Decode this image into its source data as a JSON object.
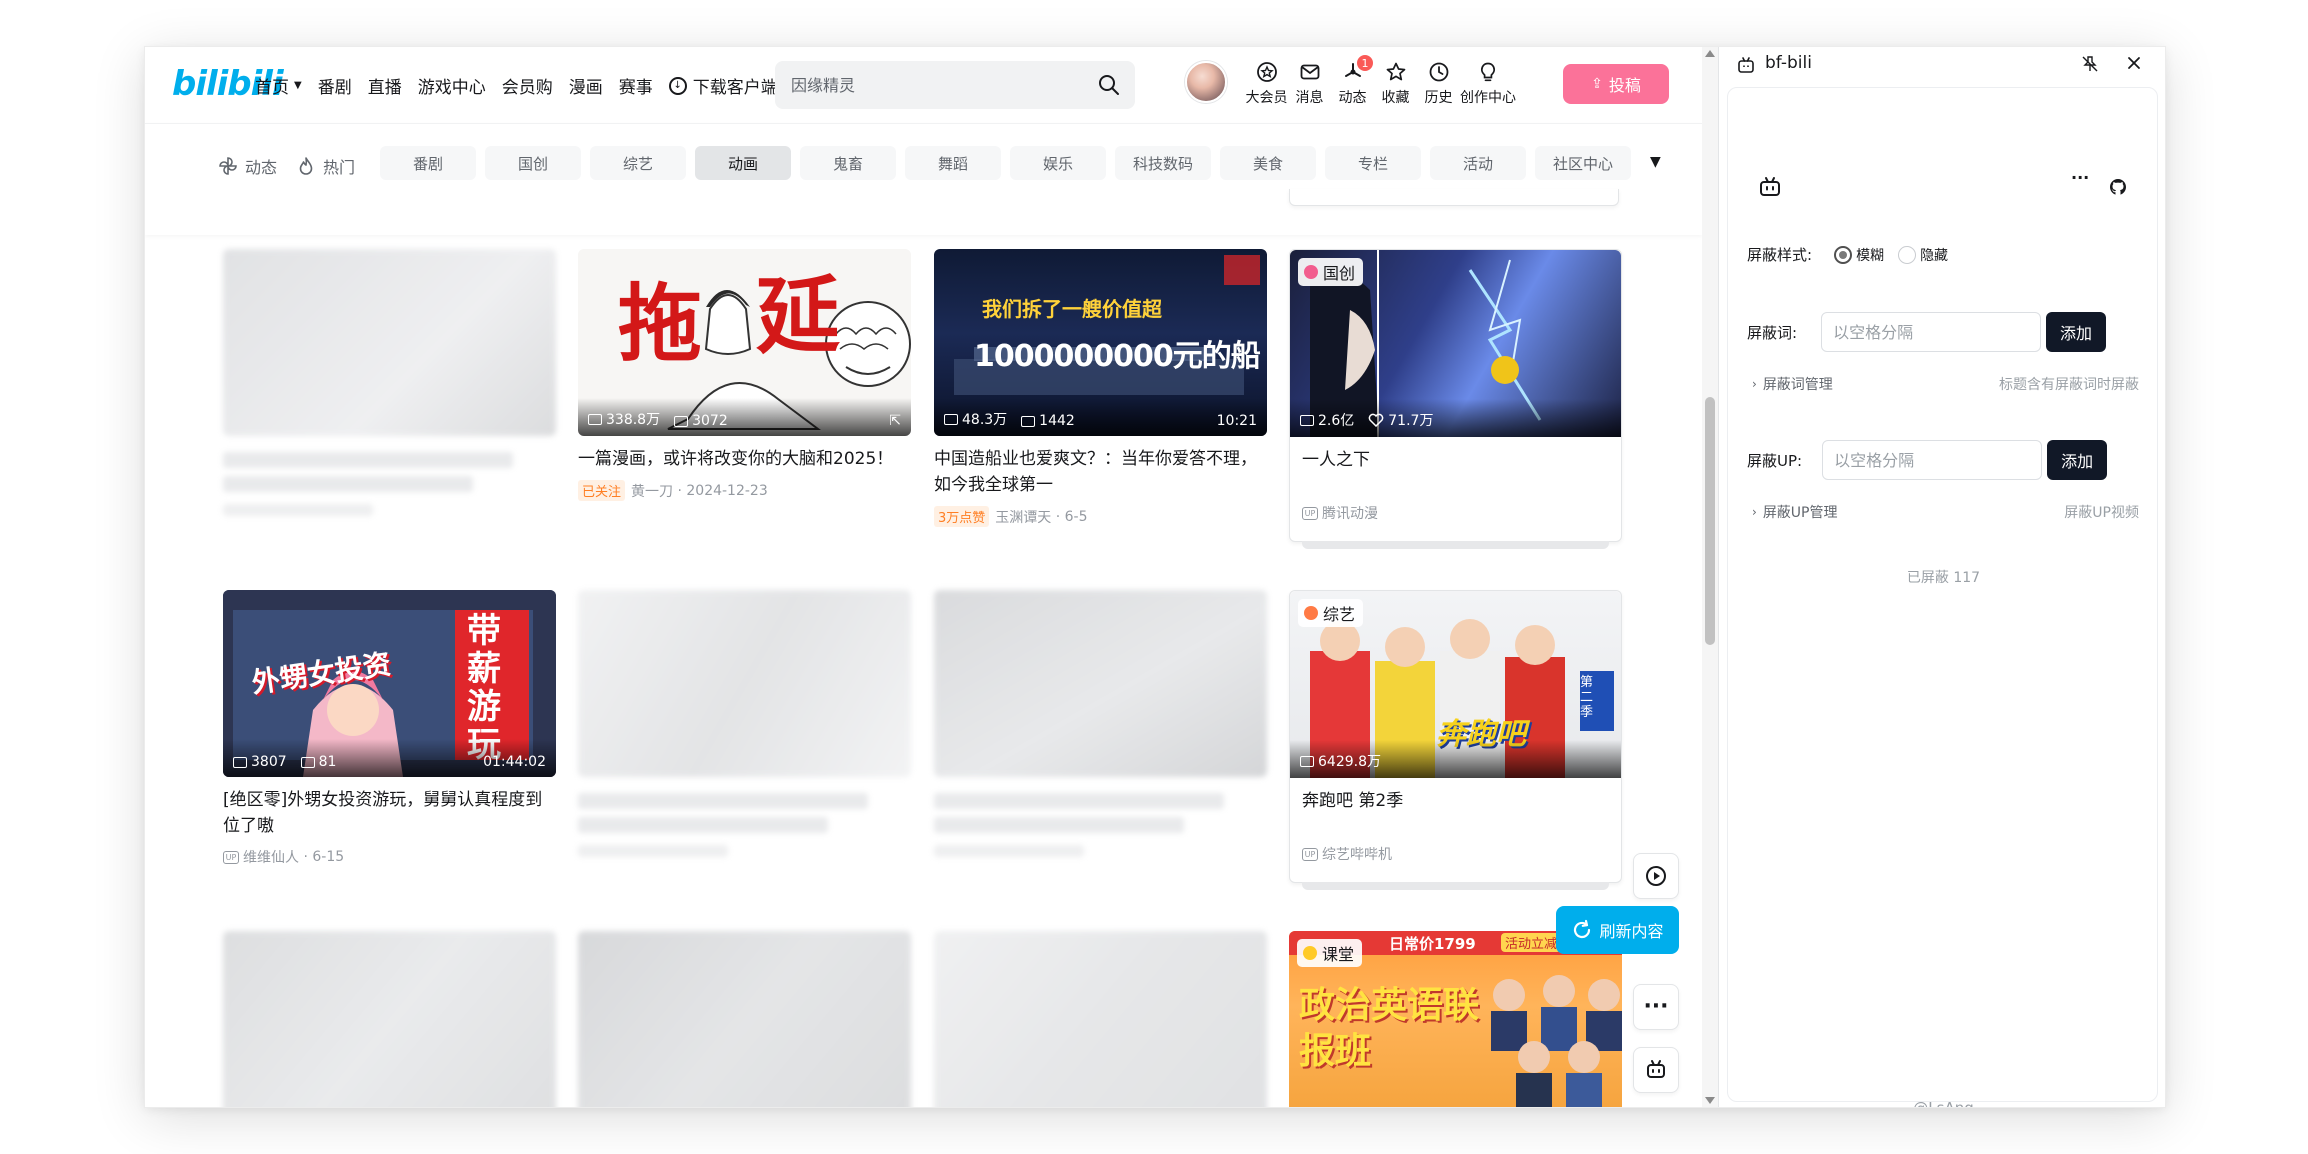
{
  "header": {
    "logo": "bilibili",
    "nav": [
      {
        "label": "首页",
        "has_dropdown": true
      },
      {
        "label": "番剧"
      },
      {
        "label": "直播"
      },
      {
        "label": "游戏中心"
      },
      {
        "label": "会员购"
      },
      {
        "label": "漫画"
      },
      {
        "label": "赛事"
      },
      {
        "label": "下载客户端",
        "icon": "download-icon"
      }
    ],
    "search_placeholder": "因缘精灵",
    "icons": [
      {
        "label": "大会员",
        "icon": "vip-icon"
      },
      {
        "label": "消息",
        "icon": "message-icon"
      },
      {
        "label": "动态",
        "icon": "dynamic-icon",
        "badge": "1"
      },
      {
        "label": "收藏",
        "icon": "star-icon"
      },
      {
        "label": "历史",
        "icon": "history-icon"
      },
      {
        "label": "创作中心",
        "icon": "creator-icon"
      }
    ],
    "upload_label": "投稿"
  },
  "channels": {
    "dynamic_label": "动态",
    "hot_label": "热门",
    "items": [
      "番剧",
      "国创",
      "综艺",
      "动画",
      "鬼畜",
      "舞蹈",
      "娱乐",
      "科技数码",
      "美食",
      "专栏",
      "活动",
      "社区中心"
    ],
    "active": "动画"
  },
  "cards": [
    {
      "title": "一篇漫画，或许将改变你的大脑和2025！",
      "views": "338.8万",
      "comments": "3072",
      "tag": "已关注",
      "author": "黄一刀",
      "date": "2024-12-23",
      "cover_text_1": "拖",
      "cover_text_2": "延"
    },
    {
      "title": "中国造船业也爱爽文？：当年你爱答不理，如今我全球第一",
      "views": "48.3万",
      "comments": "1442",
      "duration": "10:21",
      "tag": "3万点赞",
      "author": "玉渊谭天",
      "date": "6-5",
      "cover_text_1": "我们拆了一艘价值超",
      "cover_text_2": "1000000000元的船"
    },
    {
      "title": "一人之下",
      "views": "2.6亿",
      "likes": "71.7万",
      "channel_badge": "国创",
      "author": "腾讯动漫"
    },
    {
      "title": "[绝区零]外甥女投资游玩，舅舅认真程度到位了嗷",
      "views": "3807",
      "comments": "81",
      "duration": "01:44:02",
      "author": "维维仙人",
      "date": "6-15",
      "cover_text_1": "外甥女投资",
      "cover_text_2": "带薪游玩"
    },
    {
      "title": "奔跑吧 第2季",
      "views": "6429.8万",
      "channel_badge": "综艺",
      "author": "综艺哔哔机",
      "cover_text_1": "奔跑吧",
      "cover_text_2": "第二季"
    },
    {
      "channel_badge": "课堂",
      "cover_text_1": "日常价1799",
      "cover_text_2": "政治英语联报班",
      "cover_text_3": "活动立减"
    }
  ],
  "floating": {
    "refresh_label": "刷新内容"
  },
  "panel": {
    "title": "bf-bili",
    "style_label": "屏蔽样式:",
    "style_options": [
      "模糊",
      "隐藏"
    ],
    "style_selected": "模糊",
    "word_label": "屏蔽词:",
    "word_placeholder": "以空格分隔",
    "word_add": "添加",
    "word_manage": "屏蔽词管理",
    "word_hint": "标题含有屏蔽词时屏蔽",
    "up_label": "屏蔽UP:",
    "up_placeholder": "以空格分隔",
    "up_add": "添加",
    "up_manage": "屏蔽UP管理",
    "up_hint": "屏蔽UP视频",
    "blocked_count": "已屏蔽 117",
    "footer": "@LsAng",
    "more_label": "···"
  },
  "colors": {
    "brand_blue": "#00aeec",
    "brand_pink": "#fb7299",
    "panel_button": "#111827"
  }
}
